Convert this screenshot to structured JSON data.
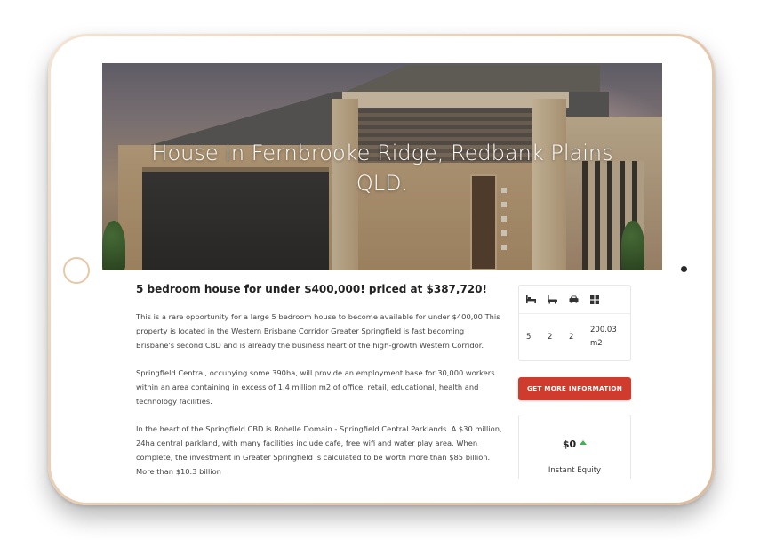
{
  "hero": {
    "title": "House in Fernbrooke Ridge, Redbank Plains QLD."
  },
  "listing": {
    "heading": "5 bedroom house for under $400,000! priced at $387,720!",
    "paragraphs": [
      "This is a rare opportunity for a large 5 bedroom house to become available for under $400,00 This property is located in the Western Brisbane Corridor Greater Springfield is fast becoming Brisbane's second CBD and is already the business heart of the high-growth Western Corridor.",
      "Springfield Central, occupying some 390ha, will provide an employment base for 30,000 workers within an area containing in excess of 1.4 million m2 of office, retail, educational, health and technology facilities.",
      "In the heart of the Springfield CBD is Robelle Domain - Springfield Central Parklands. A $30 million, 24ha central parkland, with many facilities include cafe, free wifi and water play area. When complete, the investment in Greater Springfield is calculated to be worth more than $85 billion. More than $10.3 billion"
    ]
  },
  "features": {
    "icons": [
      "bed-icon",
      "bath-icon",
      "car-icon",
      "area-icon"
    ],
    "bedrooms": "5",
    "bathrooms": "2",
    "parking": "2",
    "area": "200.03 m2"
  },
  "cta": {
    "label": "GET MORE INFORMATION"
  },
  "equity": {
    "amount": "$0",
    "label": "Instant Equity"
  },
  "colors": {
    "accent": "#cf3b2d",
    "trend_up": "#3fb34f"
  }
}
